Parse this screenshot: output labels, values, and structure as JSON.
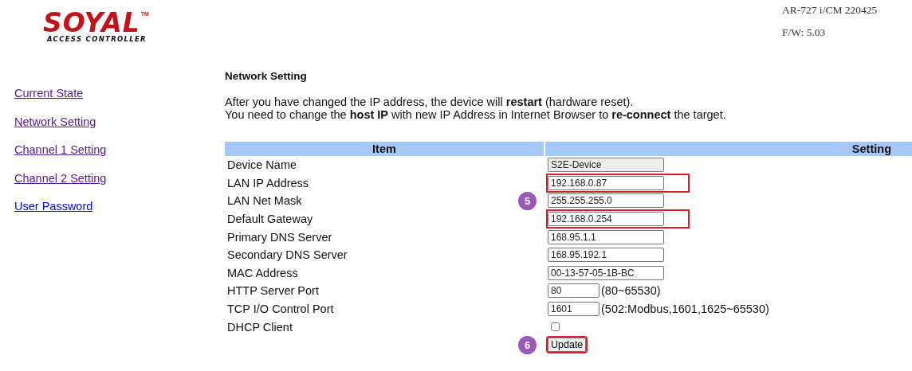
{
  "logo": {
    "brand": "SOYAL",
    "trademark": "TM",
    "tagline": "ACCESS CONTROLLER"
  },
  "device_info": {
    "model": "AR-727 i/CM 220425",
    "firmware": "F/W: 5.03"
  },
  "sidebar": {
    "items": [
      {
        "label": "Current State",
        "visited": true
      },
      {
        "label": "Network Setting",
        "visited": true
      },
      {
        "label": "Channel 1 Setting",
        "visited": true
      },
      {
        "label": "Channel 2 Setting",
        "visited": true
      },
      {
        "label": "User Password",
        "visited": false
      }
    ]
  },
  "page_title": "Network Setting",
  "notes": [
    "After you have changed the IP address, the device will **restart** (hardware reset).",
    "You need to change the **host IP** with new IP Address in Internet Browser to **re-connect** the target."
  ],
  "table": {
    "columns": [
      "Item",
      "Setting"
    ],
    "rows": [
      {
        "kind": "text",
        "item": "Device Name",
        "value": "S2E-Device",
        "readonly": true,
        "highlighted": false
      },
      {
        "kind": "text",
        "item": "LAN IP Address",
        "value": "192.168.0.87",
        "readonly": false,
        "highlighted": true
      },
      {
        "kind": "text",
        "item": "LAN Net Mask",
        "value": "255.255.255.0",
        "readonly": false,
        "highlighted": false,
        "callout": "5"
      },
      {
        "kind": "text",
        "item": "Default Gateway",
        "value": "192.168.0.254",
        "readonly": false,
        "highlighted": true
      },
      {
        "kind": "text",
        "item": "Primary DNS Server",
        "value": "168.95.1.1",
        "readonly": false,
        "highlighted": false
      },
      {
        "kind": "text",
        "item": "Secondary DNS Server",
        "value": "168.95.192.1",
        "readonly": false,
        "highlighted": false
      },
      {
        "kind": "text",
        "item": "MAC Address",
        "value": "00-13-57-05-1B-BC",
        "readonly": false,
        "highlighted": false
      },
      {
        "kind": "port",
        "item": "HTTP Server Port",
        "value": "80",
        "hint": "(80~65530)",
        "readonly": false,
        "highlighted": false
      },
      {
        "kind": "port",
        "item": "TCP I/O Control Port",
        "value": "1601",
        "hint": "(502:Modbus,1601,1625~65530)",
        "readonly": false,
        "highlighted": false
      },
      {
        "kind": "checkbox",
        "item": "DHCP Client",
        "checked": false
      }
    ]
  },
  "update_button": {
    "label": "Update",
    "highlighted": true,
    "callout": "6"
  }
}
